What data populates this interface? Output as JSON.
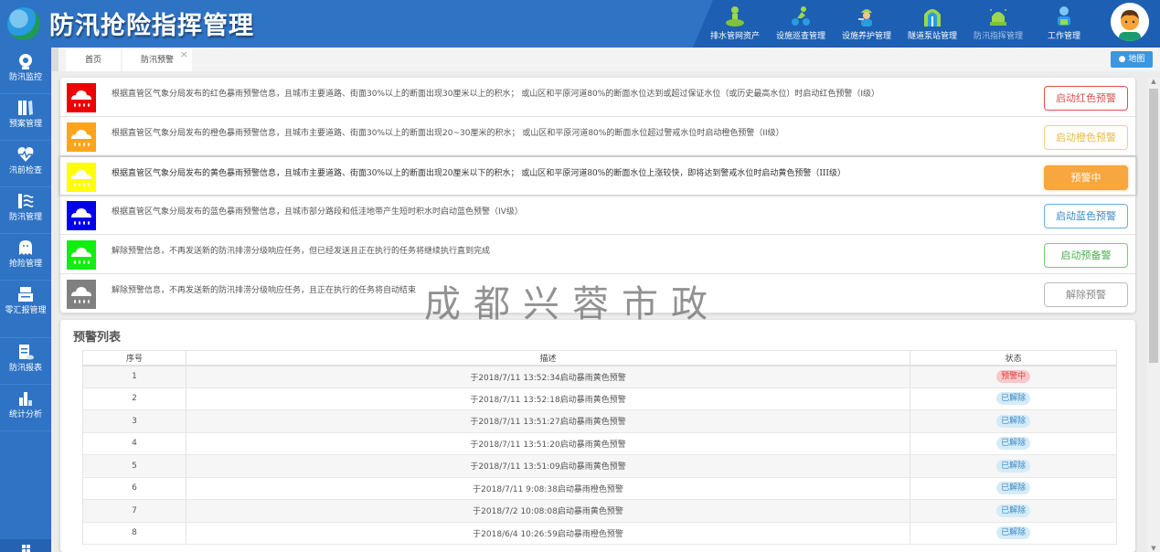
{
  "app": {
    "title": "防汛抢险指挥管理"
  },
  "topnav": [
    {
      "label": "排水管网资产",
      "icon": "pipe-network-icon"
    },
    {
      "label": "设施巡查管理",
      "icon": "cyclist-patrol-icon"
    },
    {
      "label": "设施养护管理",
      "icon": "worker-maintenance-icon"
    },
    {
      "label": "隧道泵站管理",
      "icon": "tunnel-icon"
    },
    {
      "label": "防汛指挥管理",
      "icon": "alarm-light-icon",
      "active": true
    },
    {
      "label": "工作管理",
      "icon": "office-worker-icon"
    }
  ],
  "sidebar": [
    {
      "label": "防汛监控",
      "icon": "camera-icon"
    },
    {
      "label": "预案管理",
      "icon": "binders-icon"
    },
    {
      "label": "汛前检查",
      "icon": "heartbeat-icon"
    },
    {
      "label": "防汛管理",
      "icon": "flood-wall-icon"
    },
    {
      "label": "抢险管理",
      "icon": "ghost-icon"
    },
    {
      "label": "零汇报管理",
      "icon": "printer-icon"
    },
    {
      "label": "防汛报表",
      "icon": "report-icon"
    },
    {
      "label": "统计分析",
      "icon": "bar-chart-icon"
    }
  ],
  "tabs": [
    {
      "label": "首页"
    },
    {
      "label": "防汛预警",
      "close": "×"
    }
  ],
  "map_button": {
    "label": "地图"
  },
  "warnings": [
    {
      "color": "#ee0000",
      "text": "根据直管区气象分局发布的红色暴雨预警信息，且城市主要道路、街面30%以上的断面出现30厘米以上的积水； 或山区和平原河道80%的断面水位达到或超过保证水位（或历史最高水位）时启动红色预警（I级）",
      "button": "启动红色预警",
      "btn_color": "#d9534f",
      "btn_border": "#d9534f"
    },
    {
      "color": "#ffa41b",
      "text": "根据直管区气象分局发布的橙色暴雨预警信息，且城市主要道路、街面30%以上的断面出现20~30厘米的积水； 或山区和平原河道80%的断面水位超过警戒水位时启动橙色预警（II级）",
      "button": "启动橙色预警",
      "btn_color": "#e6b84a",
      "btn_border": "#f1d27b"
    },
    {
      "color": "#ffff00",
      "text": "根据直管区气象分局发布的黄色暴雨预警信息，且城市主要道路、街面30%以上的断面出现20厘米以下的积水； 或山区和平原河道80%的断面水位上涨较快，即将达到警戒水位时启动黄色预警（III级）",
      "button": "预警中",
      "active": true,
      "btn_color": "#ffffff",
      "btn_bg": "#f8a640"
    },
    {
      "color": "#0000ee",
      "text": "根据直管区气象分局发布的蓝色暴雨预警信息，且城市部分路段和低洼地带产生短时积水时启动蓝色预警（IV级）",
      "button": "启动蓝色预警",
      "btn_color": "#3a8bc5",
      "btn_border": "#6aaedc"
    },
    {
      "color": "#11ee11",
      "text": "解除预警信息，不再发送新的防汛排涝分级响应任务，但已经发送且正在执行的任务将继续执行直到完成",
      "button": "启动预备警",
      "btn_color": "#4cae4c",
      "btn_border": "#7cc67c"
    },
    {
      "color": "#808080",
      "text": "解除预警信息，不再发送新的防汛排涝分级响应任务，且正在执行的任务将自动结束",
      "button": "解除预警",
      "btn_color": "#888888",
      "btn_border": "#bbbbbb"
    }
  ],
  "watermark": "成都兴蓉市政",
  "list": {
    "title": "预警列表",
    "columns": [
      "序号",
      "描述",
      "状态"
    ],
    "rows": [
      {
        "no": "1",
        "desc": "于2018/7/11 13:52:34启动暴雨黄色预警",
        "status": "预警中",
        "status_type": "alert"
      },
      {
        "no": "2",
        "desc": "于2018/7/11 13:52:18启动暴雨黄色预警",
        "status": "已解除",
        "status_type": "cleared"
      },
      {
        "no": "3",
        "desc": "于2018/7/11 13:51:27启动暴雨黄色预警",
        "status": "已解除",
        "status_type": "cleared"
      },
      {
        "no": "4",
        "desc": "于2018/7/11 13:51:20启动暴雨黄色预警",
        "status": "已解除",
        "status_type": "cleared"
      },
      {
        "no": "5",
        "desc": "于2018/7/11 13:51:09启动暴雨黄色预警",
        "status": "已解除",
        "status_type": "cleared"
      },
      {
        "no": "6",
        "desc": "于2018/7/11 9:08:38启动暴雨橙色预警",
        "status": "已解除",
        "status_type": "cleared"
      },
      {
        "no": "7",
        "desc": "于2018/7/2 10:08:08启动暴雨黄色预警",
        "status": "已解除",
        "status_type": "cleared"
      },
      {
        "no": "8",
        "desc": "于2018/6/4 10:26:59启动暴雨橙色预警",
        "status": "已解除",
        "status_type": "cleared"
      }
    ]
  }
}
